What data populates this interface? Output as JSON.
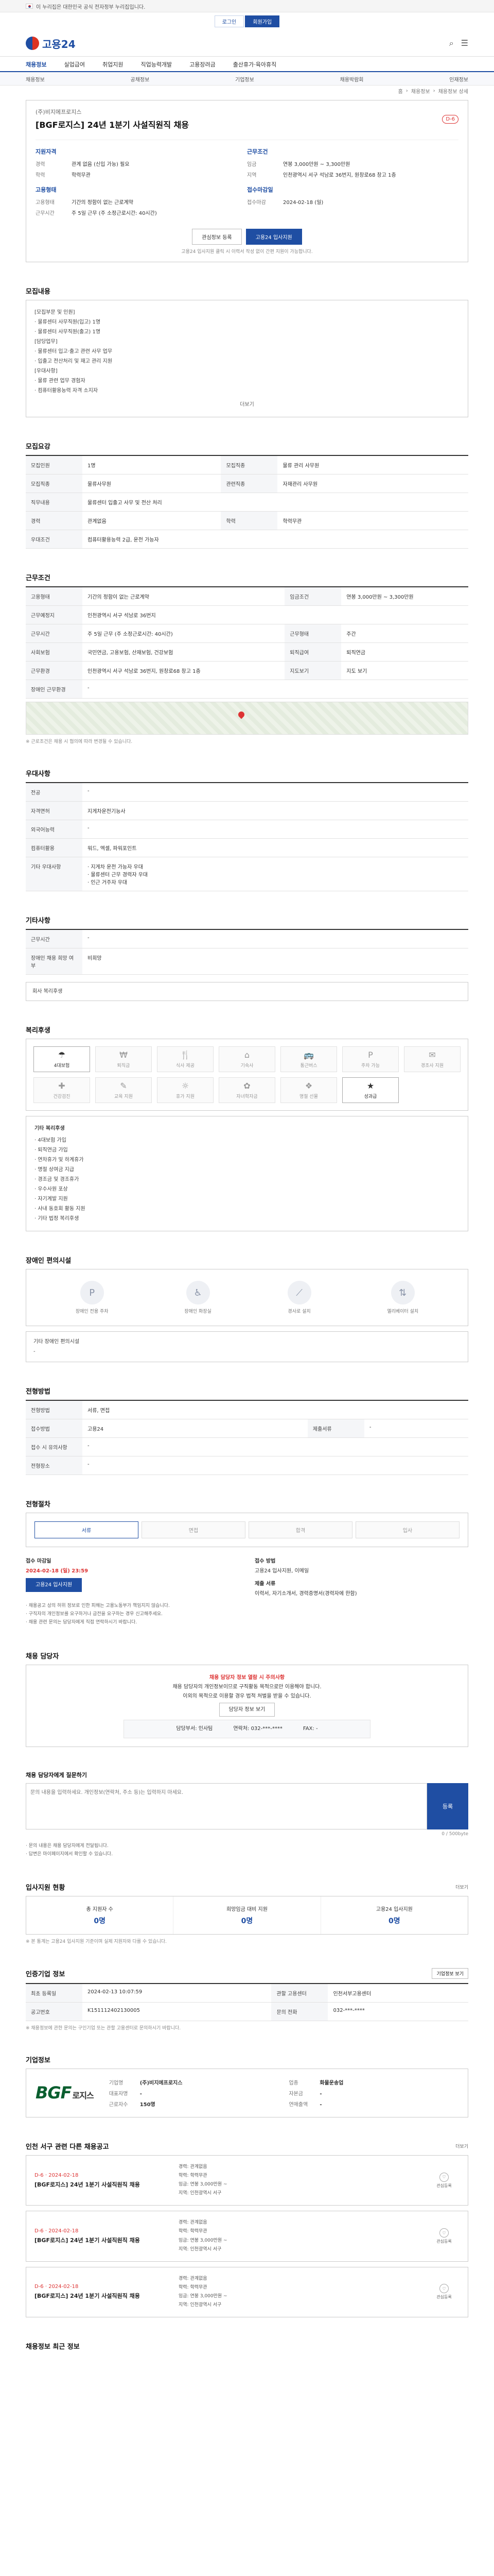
{
  "gov_strip": "이 누리집은 대한민국 공식 전자정부 누리집입니다.",
  "login_bar": {
    "left": "로그인",
    "right": "회원가입"
  },
  "brand": {
    "name": "고용24"
  },
  "nav": [
    {
      "label": "채용정보",
      "active": true
    },
    {
      "label": "실업급여"
    },
    {
      "label": "취업지원"
    },
    {
      "label": "직업능력개발"
    },
    {
      "label": "고용장려금"
    },
    {
      "label": "출산휴가·육아휴직"
    }
  ],
  "subnav": [
    "채용정보",
    "공채정보",
    "기업정보",
    "채용박람회",
    "인재정보"
  ],
  "breadcrumb": [
    "홈",
    "채용정보",
    "채용정보 상세"
  ],
  "job": {
    "company": "(주)비지에프로지스",
    "title": "[BGF로지스] 24년 1분기 사설직원직 채용",
    "dday": "D-6",
    "qual_heading": "지원자격",
    "qual": [
      {
        "k": "경력",
        "v": "관계 없음 (신입 가능) 필요"
      },
      {
        "k": "학력",
        "v": "학력무관"
      }
    ],
    "cond_heading": "근무조건",
    "cond": [
      {
        "k": "임금",
        "v": "연봉 3,000만원 ~ 3,300만원"
      },
      {
        "k": "지역",
        "v": "인천광역시 서구 석남로 36번지, 원창로68 창고 1층"
      }
    ],
    "form_heading": "고용형태",
    "form": [
      {
        "k": "고용형태",
        "v": "기간의 정함이 없는 근로계약"
      },
      {
        "k": "근무시간",
        "v": "주 5일 근무 (주 소정근로시간: 40시간)"
      }
    ],
    "period_heading": "접수마감일",
    "period": [
      {
        "k": "접수마감",
        "v": "2024-02-18 (일)"
      }
    ],
    "btn_scrap": "관심정보 등록",
    "btn_apply": "고용24 입사지원",
    "note": "고용24 입사지원 클릭 시 이력서 작성 없이 간편 지원이 가능합니다."
  },
  "recruit": {
    "title": "모집내용",
    "lines": [
      "[모집부문 및 인원]",
      "· 물류센터 사무직원(입고) 1명",
      "· 물류센터 사무직원(출고) 1명",
      "[담당업무]",
      "· 물류센터 입고·출고 관련 사무 업무",
      "· 입출고 전산처리 및 재고 관리 지원",
      "[우대사항]",
      "· 물류 관련 업무 경험자",
      "· 컴퓨터활용능력 자격 소지자"
    ],
    "more": "더보기"
  },
  "cond_table": {
    "title": "모집요강",
    "rows": [
      {
        "k": "모집인원",
        "v": "1명",
        "k2": "모집직종",
        "v2": "물류 관리 사무원"
      },
      {
        "k": "모집직종",
        "v": "물류사무원",
        "k2": "관련직종",
        "v2": "자재관리 사무원"
      },
      {
        "k": "직무내용",
        "v": "물류센터 입출고 사무 및 전산 처리"
      },
      {
        "k": "경력",
        "v": "관계없음",
        "k2": "학력",
        "v2": "학력무관"
      },
      {
        "k": "우대조건",
        "v": "컴퓨터활용능력 2급, 운전 가능자"
      }
    ]
  },
  "work_table": {
    "title": "근무조건",
    "rows": [
      {
        "k": "고용형태",
        "v": "기간의 정함이 없는 근로계약",
        "k2": "임금조건",
        "v2": "연봉 3,000만원 ~ 3,300만원"
      },
      {
        "k": "근무예정지",
        "v": "인천광역시 서구 석남로 36번지"
      },
      {
        "k": "근무시간",
        "v": "주 5일 근무 (주 소정근로시간: 40시간)",
        "k2": "근무형태",
        "v2": "주간"
      },
      {
        "k": "사회보험",
        "v": "국민연금, 고용보험, 산재보험, 건강보험",
        "k2": "퇴직급여",
        "v2": "퇴직연금"
      },
      {
        "k": "근무환경",
        "v": "인천광역시 서구 석남로 36번지, 원창로68 창고 1층",
        "k2": "지도보기",
        "v2": "지도 보기"
      },
      {
        "k": "장애인 근무환경",
        "v": "-"
      }
    ],
    "note": "※ 근로조건은 채용 시 협의에 따라 변경될 수 있습니다."
  },
  "welfare": {
    "title": "우대사항",
    "rows": [
      {
        "k": "전공",
        "v": "-"
      },
      {
        "k": "자격면허",
        "v": "지게차운전기능사"
      },
      {
        "k": "외국어능력",
        "v": "-"
      },
      {
        "k": "컴퓨터활용",
        "v": "워드, 엑셀, 파워포인트"
      },
      {
        "k": "기타 우대사항",
        "v": "· 지게차 운전 가능자 우대\n· 물류센터 근무 경력자 우대\n· 인근 거주자 우대"
      }
    ]
  },
  "extra": {
    "title": "기타사항",
    "rows": [
      {
        "k": "근무시간",
        "v": "-"
      },
      {
        "k": "장애인 채용 희망 여부",
        "v": "비희망"
      }
    ],
    "link": "회사 복리후생"
  },
  "benefits": {
    "title": "복리후생",
    "items": [
      {
        "label": "4대보험",
        "icon": "☂",
        "on": true
      },
      {
        "label": "퇴직금",
        "icon": "₩",
        "on": false
      },
      {
        "label": "식사 제공",
        "icon": "🍴",
        "on": false
      },
      {
        "label": "기숙사",
        "icon": "⌂",
        "on": false
      },
      {
        "label": "통근버스",
        "icon": "🚌",
        "on": false
      },
      {
        "label": "주차 가능",
        "icon": "P",
        "on": false
      },
      {
        "label": "경조사 지원",
        "icon": "✉",
        "on": false
      },
      {
        "label": "건강검진",
        "icon": "✚",
        "on": false
      },
      {
        "label": "교육 지원",
        "icon": "✎",
        "on": false
      },
      {
        "label": "휴가 지원",
        "icon": "☼",
        "on": false
      },
      {
        "label": "자녀학자금",
        "icon": "✿",
        "on": false
      },
      {
        "label": "명절 선물",
        "icon": "❖",
        "on": false
      },
      {
        "label": "성과급",
        "icon": "★",
        "on": true
      }
    ],
    "detail_title": "기타 복리후생",
    "detail": [
      "· 4대보험 가입",
      "· 퇴직연금 가입",
      "· 연차휴가 및 하계휴가",
      "· 명절 상여금 지급",
      "· 경조금 및 경조휴가",
      "· 우수사원 포상",
      "· 자기계발 지원",
      "· 사내 동호회 활동 지원",
      "· 기타 법정 복리후생"
    ]
  },
  "disability": {
    "title": "장애인 편의시설",
    "items": [
      "장애인 전용 주차",
      "장애인 화장실",
      "경사로 설치",
      "엘리베이터 설치"
    ],
    "sub_title": "기타 장애인 편의시설",
    "sub_value": "-"
  },
  "selection": {
    "title": "전형방법",
    "rows": [
      {
        "k": "전형방법",
        "v": "서류, 면접"
      },
      {
        "k": "접수방법",
        "v": "고용24",
        "k2": "제출서류",
        "v2": "-"
      },
      {
        "k": "접수 시 유의사항",
        "v": "-"
      },
      {
        "k": "전형장소",
        "v": "-"
      }
    ]
  },
  "process": {
    "title": "전형절차",
    "steps": [
      "서류",
      "면접",
      "합격",
      "입사"
    ],
    "period_label": "접수 마감일",
    "period_value": "2024-02-18 (일) 23:59",
    "method_label": "접수 방법",
    "method_value": "고용24 입사지원, 이메일",
    "btn": "고용24 입사지원",
    "doc_label": "제출 서류",
    "doc_value": "이력서, 자기소개서, 경력증명서(경력자에 한함)"
  },
  "cautions": [
    "· 채용공고 상의 허위 정보로 인한 피해는 고용노동부가 책임지지 않습니다.",
    "· 구직자의 개인정보를 요구하거나 금전을 요구하는 경우 신고해주세요.",
    "· 채용 관련 문의는 담당자에게 직접 연락하시기 바랍니다."
  ],
  "manager": {
    "title": "채용 담당자",
    "warn1": "채용 담당자 정보 열람 시 주의사항",
    "warn2": "채용 담당자의 개인정보이므로 구직활동 목적으로만 이용해야 합니다.",
    "warn3": "이외의 목적으로 이용할 경우 법적 처벌을 받을 수 있습니다.",
    "btn": "담당자 정보 보기",
    "dept_label": "담당부서",
    "dept": "인사팀",
    "tel_label": "연락처",
    "tel": "032-***-****",
    "fax_label": "FAX",
    "fax": "-"
  },
  "inquiry": {
    "title": "채용 담당자에게 질문하기",
    "placeholder": "문의 내용을 입력하세요. 개인정보(연락처, 주소 등)는 입력하지 마세요.",
    "count": "0 / 500byte",
    "send": "등록",
    "notes": [
      "· 문의 내용은 채용 담당자에게 전달됩니다.",
      "· 답변은 마이페이지에서 확인할 수 있습니다."
    ]
  },
  "applicants": {
    "title": "입사지원 현황",
    "more": "더보기",
    "stats": [
      {
        "label": "총 지원자 수",
        "value": "0명"
      },
      {
        "label": "희망임금 대비 지원",
        "value": "0명"
      },
      {
        "label": "고용24 입사지원",
        "value": "0명"
      }
    ],
    "note": "※ 본 통계는 고용24 입사지원 기준이며 실제 지원자와 다를 수 있습니다."
  },
  "agency": {
    "title": "인증기업 정보",
    "btn": "기업정보 보기",
    "rows": [
      {
        "k": "최초 등록일",
        "v": "2024-02-13 10:07:59",
        "k2": "관할 고용센터",
        "v2": "인천서부고용센터"
      },
      {
        "k": "공고번호",
        "v": "K151112402130005",
        "k2": "문의 전화",
        "v2": "032-***-****"
      }
    ],
    "note": "※ 채용정보에 관한 문의는 구인기업 또는 관할 고용센터로 문의하시기 바랍니다."
  },
  "company_info": {
    "title": "기업정보",
    "logo_main": "BGF",
    "logo_sub": "로지스",
    "rows": [
      {
        "k": "기업명",
        "v": "(주)비지에프로지스"
      },
      {
        "k": "업종",
        "v": "화물운송업"
      },
      {
        "k": "대표자명",
        "v": "-"
      },
      {
        "k": "자본금",
        "v": "-"
      },
      {
        "k": "근로자수",
        "v": "150명"
      },
      {
        "k": "연매출액",
        "v": "-"
      }
    ]
  },
  "related": {
    "title": "인천 서구 관련 다른 채용공고",
    "more": "더보기",
    "items": [
      {
        "dday": "D-6 · 2024-02-18",
        "title": "[BGF로지스] 24년 1분기 사설직원직 채용",
        "lines": [
          "경력: 관계없음",
          "학력: 학력무관",
          "임금: 연봉 3,000만원 ~",
          "지역: 인천광역시 서구"
        ]
      },
      {
        "dday": "D-6 · 2024-02-18",
        "title": "[BGF로지스] 24년 1분기 사설직원직 채용",
        "lines": [
          "경력: 관계없음",
          "학력: 학력무관",
          "임금: 연봉 3,000만원 ~",
          "지역: 인천광역시 서구"
        ]
      },
      {
        "dday": "D-6 · 2024-02-18",
        "title": "[BGF로지스] 24년 1분기 사설직원직 채용",
        "lines": [
          "경력: 관계없음",
          "학력: 학력무관",
          "임금: 연봉 3,000만원 ~",
          "지역: 인천광역시 서구"
        ]
      }
    ],
    "scrap": "관심등록"
  },
  "recent": {
    "title": "채용정보 최근 정보"
  }
}
